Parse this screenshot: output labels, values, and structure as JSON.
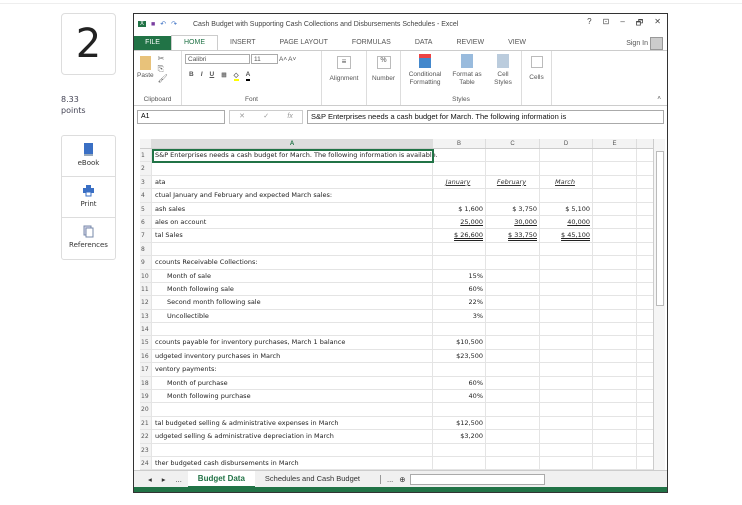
{
  "question": {
    "number": "2",
    "points_value": "8.33",
    "points_label": "points"
  },
  "tools": [
    {
      "label": "eBook",
      "icon": "book-icon"
    },
    {
      "label": "Print",
      "icon": "printer-icon"
    },
    {
      "label": "References",
      "icon": "copy-icon"
    }
  ],
  "excel": {
    "title": "Cash Budget with Supporting Cash Collections and Disbursements Schedules - Excel",
    "window_controls": [
      "?",
      "⊡",
      "–",
      "🗗",
      "✕"
    ],
    "tabs": [
      "FILE",
      "HOME",
      "INSERT",
      "PAGE LAYOUT",
      "FORMULAS",
      "DATA",
      "REVIEW",
      "VIEW"
    ],
    "sign_in": "Sign In",
    "ribbon": {
      "paste": "Paste",
      "clipboard": "Clipboard",
      "font_name": "Calibri",
      "font_size": "11",
      "font": "Font",
      "alignment": "Alignment",
      "number": "Number",
      "conditional_formatting": "Conditional Formatting",
      "format_as_table": "Format as Table",
      "cell_styles": "Cell Styles",
      "styles": "Styles",
      "cells": "Cells",
      "bold": "B",
      "italic": "I",
      "underline": "U"
    },
    "name_box": "A1",
    "fx": "fx",
    "formula": "S&P Enterprises needs a cash budget for March. The following information is",
    "columns": [
      "A",
      "B",
      "C",
      "D",
      "E"
    ],
    "rows": [
      {
        "n": "1",
        "a": "S&P Enterprises needs a cash budget for March. The following information is available.",
        "b": "",
        "c": "",
        "d": ""
      },
      {
        "n": "2",
        "a": "",
        "b": "",
        "c": "",
        "d": ""
      },
      {
        "n": "3",
        "a": "ata",
        "b": "January",
        "c": "February",
        "d": "March",
        "style": "hdr"
      },
      {
        "n": "4",
        "a": "ctual January and February and expected March sales:",
        "b": "",
        "c": "",
        "d": ""
      },
      {
        "n": "5",
        "a": "ash sales",
        "b": "$     1,600",
        "c": "$     3,750",
        "d": "$   5,100"
      },
      {
        "n": "6",
        "a": "ales on account",
        "b": "25,000",
        "c": "30,000",
        "d": "40,000",
        "style": "ul"
      },
      {
        "n": "7",
        "a": "tal Sales",
        "b": "$  26,600",
        "c": "$  33,750",
        "d": "$  45,100",
        "style": "dul"
      },
      {
        "n": "8",
        "a": "",
        "b": "",
        "c": "",
        "d": ""
      },
      {
        "n": "9",
        "a": "ccounts Receivable Collections:",
        "b": "",
        "c": "",
        "d": ""
      },
      {
        "n": "10",
        "a": "Month of sale",
        "b": "15%",
        "c": "",
        "d": "",
        "indent": true
      },
      {
        "n": "11",
        "a": "Month following sale",
        "b": "60%",
        "c": "",
        "d": "",
        "indent": true
      },
      {
        "n": "12",
        "a": "Second month following sale",
        "b": "22%",
        "c": "",
        "d": "",
        "indent": true
      },
      {
        "n": "13",
        "a": "Uncollectible",
        "b": "3%",
        "c": "",
        "d": "",
        "indent": true
      },
      {
        "n": "14",
        "a": "",
        "b": "",
        "c": "",
        "d": ""
      },
      {
        "n": "15",
        "a": "ccounts payable for inventory purchases, March 1 balance",
        "b": "$10,500",
        "c": "",
        "d": ""
      },
      {
        "n": "16",
        "a": "udgeted inventory purchases in March",
        "b": "$23,500",
        "c": "",
        "d": ""
      },
      {
        "n": "17",
        "a": "ventory payments:",
        "b": "",
        "c": "",
        "d": ""
      },
      {
        "n": "18",
        "a": "Month of purchase",
        "b": "60%",
        "c": "",
        "d": "",
        "indent": true
      },
      {
        "n": "19",
        "a": "Month following purchase",
        "b": "40%",
        "c": "",
        "d": "",
        "indent": true
      },
      {
        "n": "20",
        "a": "",
        "b": "",
        "c": "",
        "d": ""
      },
      {
        "n": "21",
        "a": "tal budgeted selling & administrative expenses in March",
        "b": "$12,500",
        "c": "",
        "d": ""
      },
      {
        "n": "22",
        "a": "udgeted selling & administrative depreciation in March",
        "b": "$3,200",
        "c": "",
        "d": ""
      },
      {
        "n": "23",
        "a": "",
        "b": "",
        "c": "",
        "d": ""
      },
      {
        "n": "24",
        "a": "ther budgeted cash disbursements in March",
        "b": "",
        "c": "",
        "d": ""
      }
    ],
    "sheet_tabs": [
      "Budget Data",
      "Schedules and Cash Budget"
    ],
    "sheet_nav": {
      "prev": "◂",
      "next": "▸",
      "more": "...",
      "add": "⊕"
    }
  }
}
